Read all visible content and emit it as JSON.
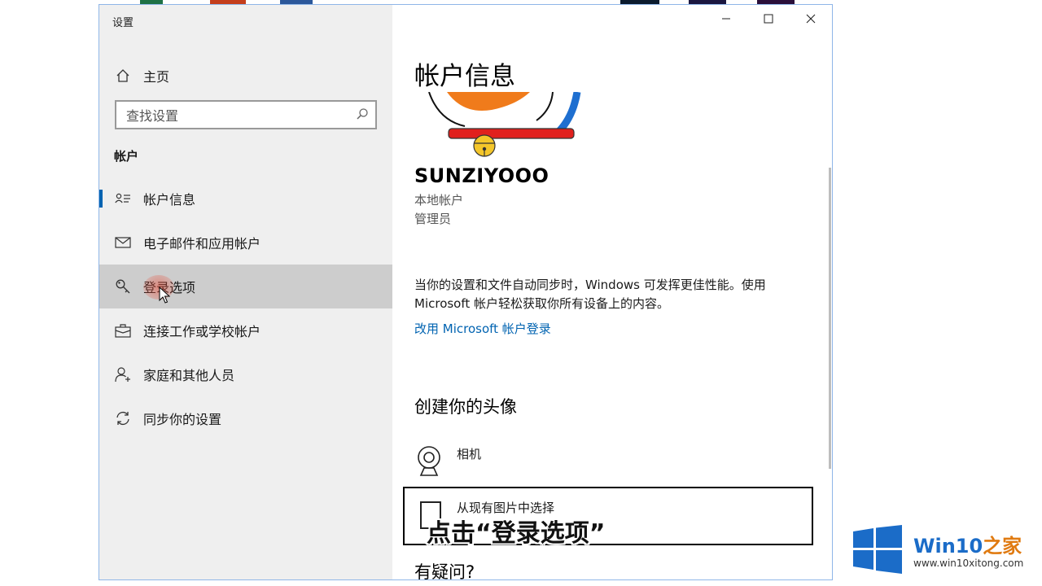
{
  "window": {
    "title": "设置"
  },
  "sidebar": {
    "home_label": "主页",
    "search_placeholder": "查找设置",
    "group_heading": "帐户",
    "items": [
      {
        "label": "帐户信息",
        "icon": "account-info-icon"
      },
      {
        "label": "电子邮件和应用帐户",
        "icon": "mail-icon"
      },
      {
        "label": "登录选项",
        "icon": "key-icon"
      },
      {
        "label": "连接工作或学校帐户",
        "icon": "briefcase-icon"
      },
      {
        "label": "家庭和其他人员",
        "icon": "person-add-icon"
      },
      {
        "label": "同步你的设置",
        "icon": "sync-icon"
      }
    ]
  },
  "content": {
    "page_title": "帐户信息",
    "username": "SUNZIYOOO",
    "account_type": "本地帐户",
    "role": "管理员",
    "description": "当你的设置和文件自动同步时，Windows 可发挥更佳性能。使用 Microsoft 帐户轻松获取你所有设备上的内容。",
    "ms_link": "改用 Microsoft 帐户登录",
    "avatar_section_heading": "创建你的头像",
    "camera_label": "相机",
    "browse_label": "从现有图片中选择",
    "question_heading": "有疑问?"
  },
  "caption": "点击“登录选项”",
  "watermark": {
    "title_win": "Win10",
    "title_zh": "之家",
    "url": "www.win10xitong.com"
  },
  "colors": {
    "accent": "#0063b1",
    "sidebar_bg": "#efefef",
    "hover_bg": "#cdcdcd",
    "watermark_blue": "#1b6cc8",
    "watermark_orange": "#e07a10"
  }
}
